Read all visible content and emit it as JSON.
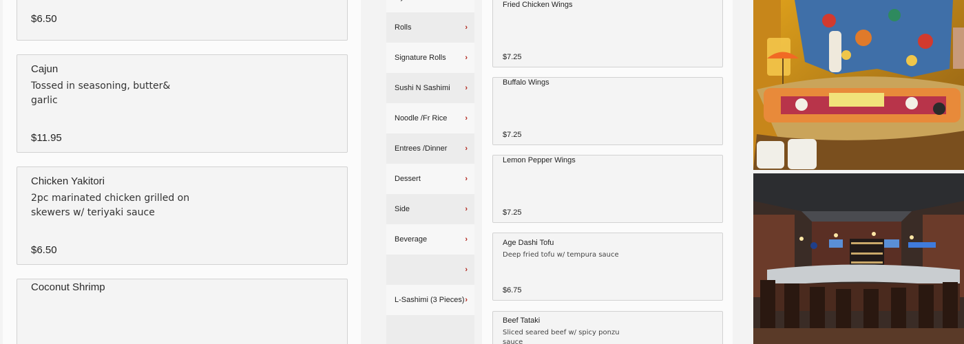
{
  "left_items": [
    {
      "title": "",
      "desc": "",
      "price": "$6.50"
    },
    {
      "title": "Cajun",
      "desc": "Tossed in seasoning, butter& garlic",
      "price": "$11.95"
    },
    {
      "title": "Chicken Yakitori",
      "desc": "2pc marinated chicken grilled on skewers w/ teriyaki sauce",
      "price": "$6.50"
    },
    {
      "title": "Coconut Shrimp",
      "desc": "",
      "price": ""
    }
  ],
  "categories": [
    {
      "label": "Oyster"
    },
    {
      "label": "Rolls"
    },
    {
      "label": "Signature Rolls"
    },
    {
      "label": "Sushi N Sashimi"
    },
    {
      "label": "Noodle /Fr Rice"
    },
    {
      "label": "Entrees /Dinner"
    },
    {
      "label": "Dessert"
    },
    {
      "label": "Side"
    },
    {
      "label": "Beverage"
    },
    {
      "label": ""
    },
    {
      "label": "L-Sashimi (3 Pieces)"
    },
    {
      "label": ""
    }
  ],
  "mid_items": [
    {
      "title": "Fried Chicken Wings",
      "desc": "",
      "price": "$7.25"
    },
    {
      "title": "Buffalo Wings",
      "desc": "",
      "price": "$7.25"
    },
    {
      "title": "Lemon Pepper Wings",
      "desc": "",
      "price": "$7.25"
    },
    {
      "title": "Age Dashi Tofu",
      "desc": "Deep fried tofu w/ tempura sauce",
      "price": "$6.75"
    },
    {
      "title": "Beef Tataki",
      "desc": "Sliced seared beef w/ spicy ponzu sauce",
      "price": ""
    }
  ],
  "icons": {
    "chevron": "›"
  },
  "colors": {
    "accent": "#b0241a"
  }
}
